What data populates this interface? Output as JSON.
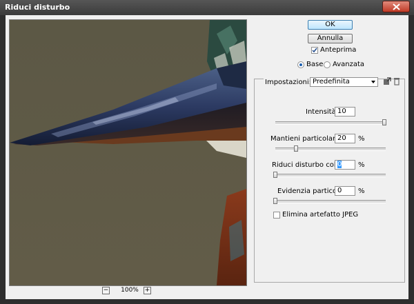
{
  "window": {
    "title": "Riduci disturbo"
  },
  "buttons": {
    "ok": "OK",
    "cancel": "Annulla"
  },
  "preview_toggle": {
    "label": "Anteprima",
    "checked": true
  },
  "mode": {
    "base": "Base",
    "advanced": "Avanzata",
    "selected": "Base"
  },
  "settings": {
    "label": "Impostazioni:",
    "value": "Predefinita"
  },
  "controls": {
    "strength": {
      "label": "Intensità:",
      "value": "10",
      "unit": "",
      "slider_fraction": 1.0
    },
    "preserve_details": {
      "label": "Mantieni particolari:",
      "value": "20",
      "unit": "%",
      "slider_fraction": 0.2
    },
    "reduce_color_noise": {
      "label": "Riduci disturbo colore:",
      "value": "0",
      "unit": "%",
      "slider_fraction": 0.0
    },
    "sharpen_details": {
      "label": "Evidenzia particolari:",
      "value": "0",
      "unit": "%",
      "slider_fraction": 0.0
    }
  },
  "jpeg_artifact": {
    "label": "Elimina artefatto JPEG",
    "checked": false
  },
  "zoom": {
    "level": "100%",
    "minus": "−",
    "plus": "+"
  },
  "icons": {
    "save_settings": "save-settings-icon",
    "delete_settings": "trash-icon",
    "close": "close-icon",
    "check": "check-icon"
  }
}
